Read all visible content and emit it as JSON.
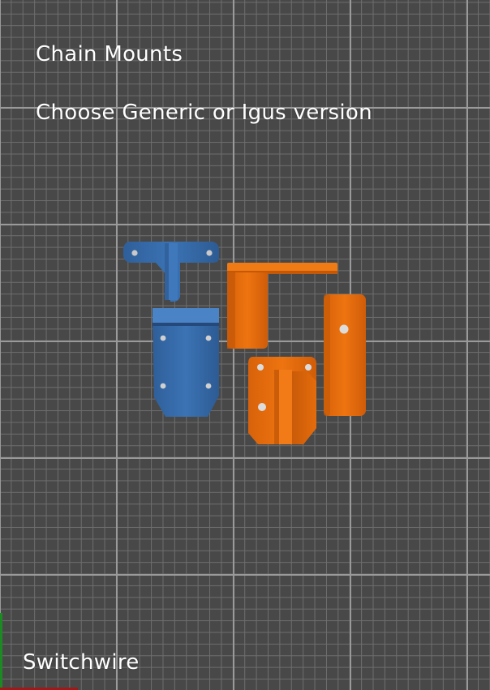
{
  "scene": {
    "title": "Chain Mounts",
    "subtitle": "Choose Generic or Igus version",
    "footer_label": "Switchwire"
  },
  "colors": {
    "background": "#484848",
    "grid_minor": "#6e6e6e",
    "grid_major": "#9a9a9a",
    "part_blue": "#3a6fae",
    "part_orange": "#e06a0a",
    "axis_x": "#a01818",
    "axis_y": "#1c8a22"
  },
  "parts": [
    {
      "name": "generic-chain-mount-bracket",
      "color": "blue"
    },
    {
      "name": "generic-chain-mount-plate",
      "color": "blue"
    },
    {
      "name": "igus-chain-mount-angle",
      "color": "orange"
    },
    {
      "name": "igus-chain-mount-block",
      "color": "orange"
    },
    {
      "name": "igus-chain-mount-strip",
      "color": "orange"
    }
  ]
}
